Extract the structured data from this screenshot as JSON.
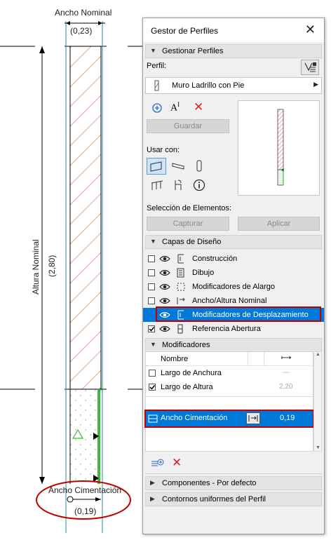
{
  "drawing": {
    "top_dimension_label": "Ancho Nominal",
    "top_dimension_value": "(0,23)",
    "side_dimension_label": "Altura Nominal",
    "side_dimension_value": "(2,80)",
    "bottom_dimension_label": "Ancho Cimentación",
    "bottom_dimension_value": "(0,19)"
  },
  "panel": {
    "title": "Gestor de Perfiles",
    "close_label": "✕",
    "section_manage": "Gestionar Perfiles",
    "profile_label": "Perfil:",
    "profile_value": "Muro Ladrillo con Pie",
    "save_label": "Guardar",
    "use_with_label": "Usar con:",
    "element_selection_label": "Selección de Elementos:",
    "capture_label": "Capturar",
    "apply_label": "Aplicar",
    "section_layers": "Capas de Diseño",
    "layers": [
      {
        "label": "Construcción",
        "icon": "construction-layer-icon",
        "checked": false
      },
      {
        "label": "Dibujo",
        "icon": "drawing-layer-icon",
        "checked": false
      },
      {
        "label": "Modificadores de Alargo",
        "icon": "stretch-modifier-icon",
        "checked": false
      },
      {
        "label": "Ancho/Altura Nominal",
        "icon": "nominal-size-icon",
        "checked": false
      },
      {
        "label": "Modificadores de Desplazamiento",
        "icon": "offset-modifier-icon",
        "checked": false,
        "selected": true
      },
      {
        "label": "Referencia Abertura",
        "icon": "opening-reference-icon",
        "checked": true
      }
    ],
    "section_modifiers": "Modificadores",
    "modifiers_header_name": "Nombre",
    "modifiers": [
      {
        "name": "Largo de Anchura",
        "checked": false,
        "value": "---"
      },
      {
        "name": "Largo de Altura",
        "checked": true,
        "value": "2,20"
      }
    ],
    "selected_modifier": {
      "name": "Ancho Cimentación",
      "value": "0,19"
    },
    "section_components": "Componentes - Por defecto",
    "section_contours": "Contornos uniformes del Perfil"
  },
  "colors": {
    "selection_blue": "#0078d7",
    "highlight_red": "#c00000",
    "hatch_red": "#e8a090",
    "guide_cyan": "#2a8fa0",
    "stretch_green": "#3cba3c"
  }
}
